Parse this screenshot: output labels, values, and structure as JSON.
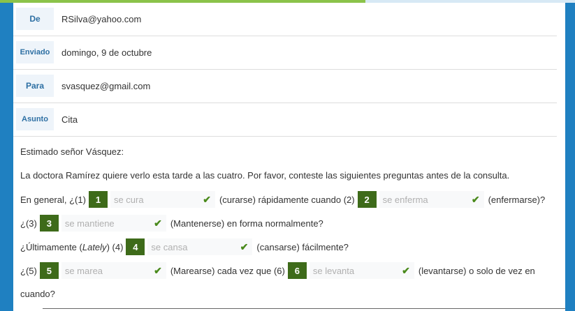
{
  "header": [
    {
      "label": "De",
      "value": "RSilva@yahoo.com"
    },
    {
      "label": "Enviado",
      "value": "domingo, 9 de octubre"
    },
    {
      "label": "Para",
      "value": "svasquez@gmail.com"
    },
    {
      "label": "Asunto",
      "value": "Cita"
    }
  ],
  "body": {
    "greeting": "Estimado señor Vásquez:",
    "intro": "La doctora Ramírez quiere verlo esta tarde a las cuatro. Por favor, conteste las siguientes preguntas antes de la consulta.",
    "q1_pre": "En general, ¿(1)",
    "q1_num": "1",
    "q1_answer": "se cura",
    "q1_mid": "(curarse) rápidamente cuando (2)",
    "q2_num": "2",
    "q2_answer": "se enferma",
    "q2_post": "(enfermarse)?",
    "q3_pre": "¿(3)",
    "q3_num": "3",
    "q3_answer": "se mantiene",
    "q3_post": "(Mantenerse) en forma normalmente?",
    "q4_pre": "¿Últimamente (",
    "q4_italic": "Lately",
    "q4_pre2": ") (4)",
    "q4_num": "4",
    "q4_answer": "se cansa",
    "q4_post": "(cansarse) fácilmente?",
    "q5_pre": "¿(5)",
    "q5_num": "5",
    "q5_answer": "se marea",
    "q5_mid": "(Marearse) cada vez que (6)",
    "q6_num": "6",
    "q6_answer": "se levanta",
    "q6_post": "(levantarse) o solo de vez en",
    "q6_cont": "cuando?"
  },
  "colors": {
    "frame": "#1f80c1",
    "progress": "#8bc34a",
    "number_badge": "#3e6b1a",
    "check": "#4a8a1c"
  }
}
